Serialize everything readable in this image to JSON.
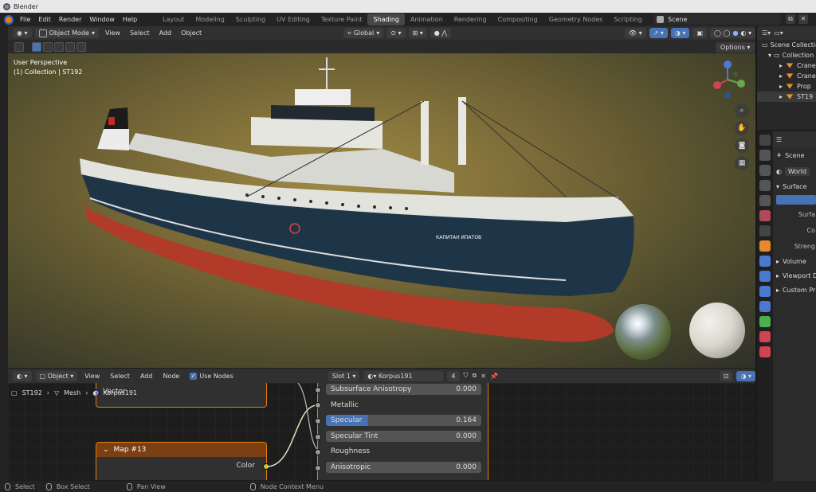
{
  "window": {
    "title": "Blender"
  },
  "menu": [
    "File",
    "Edit",
    "Render",
    "Window",
    "Help"
  ],
  "workspaces": [
    {
      "label": "Layout",
      "active": false
    },
    {
      "label": "Modeling",
      "active": false
    },
    {
      "label": "Sculpting",
      "active": false
    },
    {
      "label": "UV Editing",
      "active": false
    },
    {
      "label": "Texture Paint",
      "active": false
    },
    {
      "label": "Shading",
      "active": true
    },
    {
      "label": "Animation",
      "active": false
    },
    {
      "label": "Rendering",
      "active": false
    },
    {
      "label": "Compositing",
      "active": false
    },
    {
      "label": "Geometry Nodes",
      "active": false
    },
    {
      "label": "Scripting",
      "active": false
    }
  ],
  "add_workspace": "+",
  "scene": {
    "name": "Scene"
  },
  "viewport": {
    "mode": "Object Mode",
    "menus": [
      "View",
      "Select",
      "Add",
      "Object"
    ],
    "orientation": "Global",
    "perspective": "User Perspective",
    "collection_info": "(1) Collection | ST192",
    "options": "Options",
    "ship_name": "КАПИТАН ИПАТОВ"
  },
  "outliner": {
    "rows": [
      {
        "label": "Scene Collection",
        "icon": "collection-icon"
      },
      {
        "label": "Collection",
        "icon": "collection-icon"
      },
      {
        "label": "Crane",
        "icon": "mesh-icon"
      },
      {
        "label": "Crane",
        "icon": "mesh-icon"
      },
      {
        "label": "Prop",
        "icon": "mesh-icon"
      },
      {
        "label": "ST19",
        "icon": "mesh-icon"
      }
    ]
  },
  "properties": {
    "scene_label": "Scene",
    "world_label": "World",
    "surface_panel": "Surface",
    "surface_field": "Surfa",
    "color_field": "Co",
    "strength_field": "Streng",
    "volume_panel": "Volume",
    "viewport_panel": "Viewport D",
    "custom_panel": "Custom Pr"
  },
  "node_editor": {
    "type": "Object",
    "menus": [
      "View",
      "Select",
      "Add",
      "Node"
    ],
    "use_nodes": "Use Nodes",
    "slot": "Slot 1",
    "material": "Korpus191",
    "users": "4",
    "breadcrumb": [
      "ST192",
      "Mesh",
      "Korpus191"
    ],
    "vector_label": "Vector",
    "map_node": {
      "title": "Map #13",
      "output": "Color"
    },
    "bsdf_rows": [
      {
        "label": "Subsurface Anisotropy",
        "value": "0.000",
        "kind": "field"
      },
      {
        "label": "Metallic",
        "value": "",
        "kind": "label"
      },
      {
        "label": "Specular",
        "value": "0.164",
        "kind": "spec"
      },
      {
        "label": "Specular Tint",
        "value": "0.000",
        "kind": "field"
      },
      {
        "label": "Roughness",
        "value": "",
        "kind": "label"
      },
      {
        "label": "Anisotropic",
        "value": "0.000",
        "kind": "field"
      }
    ]
  },
  "statusbar": [
    "Select",
    "Box Select",
    "Pan View",
    "Node Context Menu"
  ],
  "colors": {
    "accent": "#4772b3",
    "node_border": "#e87d0d",
    "hull_red": "#b83a2a",
    "hull_navy": "#1d3345"
  }
}
